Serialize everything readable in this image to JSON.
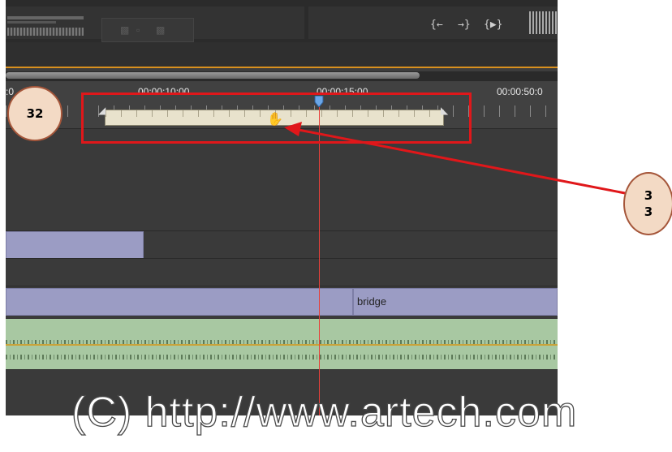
{
  "timeline": {
    "timecodes": [
      "00:00:10:00",
      "00:00:15:00",
      "00:00:50:0"
    ],
    "ruler_start_fragment": ":0",
    "trim_buttons": [
      "{←",
      "→}",
      "{▶}"
    ],
    "clips": {
      "video_clip_label": "bridge"
    },
    "icons": [
      "hand-cursor-icon",
      "playhead-icon",
      "zoom-handle-left-icon",
      "zoom-handle-right-icon"
    ]
  },
  "annotations": {
    "callout_left": "32",
    "callout_right_line1": "3",
    "callout_right_line2": "3",
    "box_color": "#e0171a"
  },
  "watermark": "(C) http://www.artech.com"
}
